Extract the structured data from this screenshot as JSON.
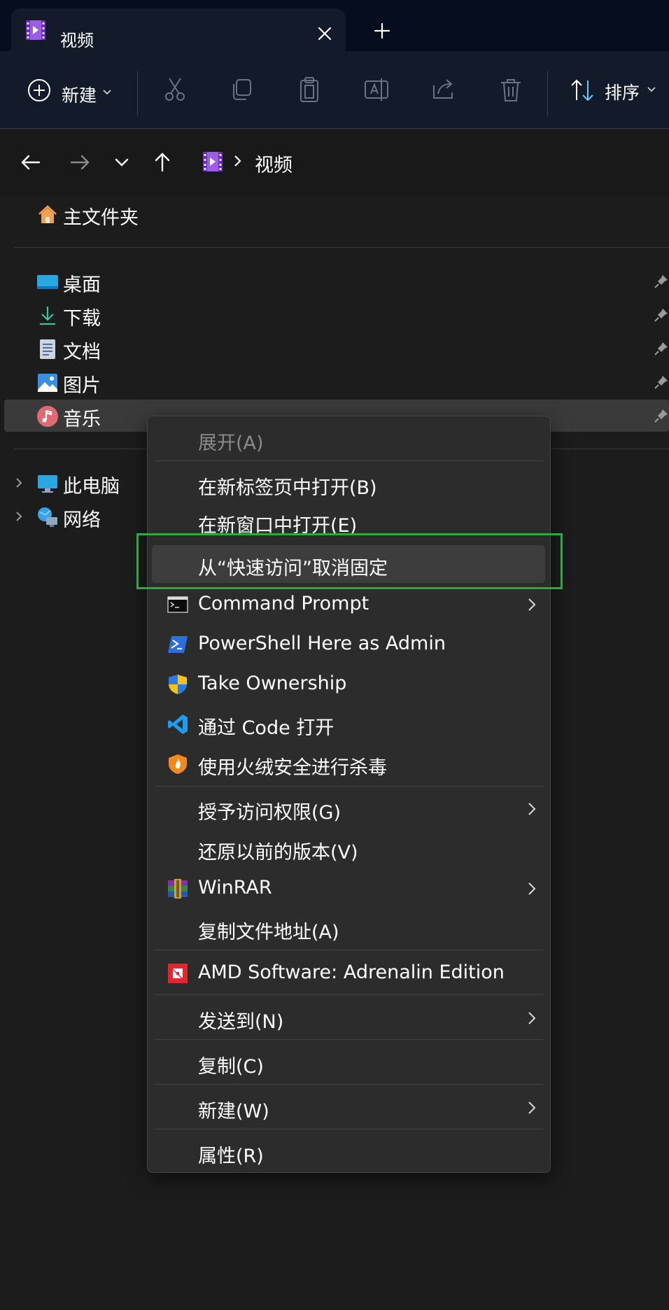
{
  "tab": {
    "title": "视频"
  },
  "toolbar": {
    "new_label": "新建",
    "sort_label": "排序"
  },
  "address": {
    "current": "视频"
  },
  "nav": {
    "home": "主文件夹",
    "quick_access": [
      "桌面",
      "下载",
      "文档",
      "图片",
      "音乐"
    ],
    "this_pc": "此电脑",
    "network": "网络"
  },
  "context_menu": {
    "items": [
      "展开(A)",
      "在新标签页中打开(B)",
      "在新窗口中打开(E)",
      "从“快速访问”取消固定",
      "Command Prompt",
      "PowerShell Here as Admin",
      "Take Ownership",
      "通过 Code 打开",
      "使用火绒安全进行杀毒",
      "授予访问权限(G)",
      "还原以前的版本(V)",
      "WinRAR",
      "复制文件地址(A)",
      "AMD Software: Adrenalin Edition",
      "发送到(N)",
      "复制(C)",
      "新建(W)",
      "属性(R)"
    ]
  },
  "colors": {
    "highlight_border": "#2ca84a",
    "accent": "#60cdff",
    "menu_bg": "#2c2c2c",
    "titlebar_bg": "#060d1e"
  }
}
